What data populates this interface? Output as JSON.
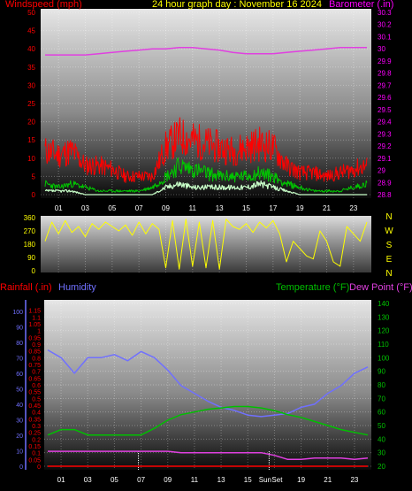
{
  "header": {
    "wind_label": "Windspeed (mph)",
    "title": "24 hour graph day : November 16 2024",
    "baro_label": "Barometer (.in)",
    "rain_label": "Rainfall (.in)",
    "humidity_label": "Humidity",
    "temp_label": "Temperature (°F)",
    "dew_label": "Dew Point (°F)"
  },
  "colors": {
    "wind": "#ff0000",
    "gust": "#ff0000",
    "wind_avg": "#00c800",
    "wind_low": "#c8ffc8",
    "barometer": "#e040e0",
    "direction": "#ffff00",
    "temperature": "#00c000",
    "dewpoint": "#e040e0",
    "humidity": "#7070ff",
    "rainfall": "#ff0000",
    "axis_left": "#ff0000",
    "axis_right": "#ff00ff",
    "hour_tick": "#ffffff"
  },
  "compass": [
    "N",
    "W",
    "S",
    "E",
    "N"
  ],
  "chart_data": [
    {
      "type": "line",
      "name": "wind",
      "x_ticks": [
        "01",
        "03",
        "05",
        "07",
        "09",
        "11",
        "13",
        "15",
        "17",
        "19",
        "21",
        "23"
      ],
      "y_left_ticks": [
        "0",
        "5",
        "10",
        "15",
        "20",
        "25",
        "30",
        "35",
        "40",
        "45",
        "50"
      ],
      "y_right_ticks": [
        "28.8",
        "28.9",
        "29",
        "29.1",
        "29.2",
        "29.3",
        "29.4",
        "29.5",
        "29.6",
        "29.7",
        "29.8",
        "29.9",
        "30",
        "30.1",
        "30.2",
        "30.3"
      ],
      "ylim_left": [
        0,
        50
      ],
      "ylim_right": [
        28.8,
        30.3
      ],
      "hours": [
        0,
        1,
        2,
        3,
        4,
        5,
        6,
        7,
        8,
        9,
        10,
        11,
        12,
        13,
        14,
        15,
        16,
        17,
        18,
        19,
        20,
        21,
        22,
        23,
        24
      ],
      "gust": [
        12,
        11,
        12,
        8,
        8,
        7,
        5,
        5,
        5,
        13,
        16,
        15,
        14,
        13,
        12,
        13,
        14,
        13,
        8,
        6,
        6,
        5,
        6,
        7,
        8
      ],
      "wind_avg": [
        3,
        2,
        3,
        2,
        1,
        1,
        1,
        1,
        2,
        5,
        8,
        7,
        6,
        5,
        5,
        5,
        6,
        5,
        3,
        2,
        1,
        1,
        1,
        2,
        3
      ],
      "wind_low": [
        1,
        1,
        1,
        0,
        0,
        0,
        0,
        0,
        0,
        2,
        3,
        2,
        2,
        2,
        2,
        2,
        3,
        2,
        1,
        0,
        0,
        0,
        0,
        0,
        0
      ],
      "barometer": [
        29.95,
        29.95,
        29.95,
        29.95,
        29.96,
        29.97,
        29.98,
        29.99,
        30.0,
        30.0,
        30.01,
        30.01,
        30.0,
        29.99,
        29.97,
        29.96,
        29.96,
        29.96,
        29.97,
        29.98,
        29.99,
        30.0,
        30.01,
        30.01,
        30.01
      ]
    },
    {
      "type": "line",
      "name": "wind-direction",
      "x_ticks": [
        "01",
        "03",
        "05",
        "07",
        "09",
        "11",
        "13",
        "15",
        "17",
        "19",
        "21",
        "23"
      ],
      "y_ticks": [
        "0",
        "90",
        "180",
        "270",
        "360"
      ],
      "ylim": [
        0,
        360
      ],
      "hours": [
        0,
        0.5,
        1,
        1.5,
        2,
        2.5,
        3,
        3.5,
        4,
        4.5,
        5,
        5.5,
        6,
        6.5,
        7,
        7.5,
        8,
        8.5,
        9,
        9.5,
        10,
        10.5,
        11,
        11.5,
        12,
        12.5,
        13,
        13.5,
        14,
        14.5,
        15,
        15.5,
        16,
        16.5,
        17,
        17.5,
        18,
        18.5,
        19,
        19.5,
        20,
        20.5,
        21,
        21.5,
        22,
        22.5,
        23,
        23.5,
        24
      ],
      "direction": [
        200,
        330,
        250,
        340,
        260,
        300,
        230,
        320,
        280,
        330,
        300,
        270,
        310,
        240,
        330,
        250,
        320,
        280,
        20,
        340,
        10,
        350,
        30,
        330,
        20,
        340,
        10,
        350,
        300,
        280,
        320,
        260,
        330,
        290,
        340,
        250,
        60,
        200,
        150,
        100,
        80,
        270,
        200,
        60,
        30,
        300,
        250,
        200,
        330
      ]
    },
    {
      "type": "line",
      "name": "temperature-humidity",
      "x_ticks": [
        "01",
        "03",
        "05",
        "07",
        "09",
        "11",
        "13",
        "15",
        "Sun",
        "Set",
        "19",
        "21",
        "23"
      ],
      "y_left_rain_ticks": [
        "0",
        "0.05",
        "0.1",
        "0.15",
        "0.2",
        "0.25",
        "0.3",
        "0.35",
        "0.4",
        "0.45",
        "0.5",
        "0.55",
        "0.6",
        "0.65",
        "0.7",
        "0.75",
        "0.8",
        "0.85",
        "0.9",
        "0.95",
        "1",
        "1.05",
        "1.1",
        "1.15"
      ],
      "y_left_humidity_ticks": [
        "0",
        "10",
        "20",
        "30",
        "40",
        "50",
        "60",
        "70",
        "80",
        "90",
        "100"
      ],
      "y_right_ticks": [
        "20",
        "30",
        "40",
        "50",
        "60",
        "70",
        "80",
        "90",
        "100",
        "110",
        "120",
        "130",
        "140"
      ],
      "ylim_rain": [
        0,
        1.2
      ],
      "ylim_humidity": [
        0,
        105
      ],
      "ylim_temp": [
        20,
        140
      ],
      "hours": [
        0,
        1,
        2,
        3,
        4,
        5,
        6,
        7,
        8,
        9,
        10,
        11,
        12,
        13,
        14,
        15,
        16,
        17,
        18,
        19,
        20,
        21,
        22,
        23,
        24
      ],
      "temperature": [
        43,
        47,
        47,
        43,
        43,
        43,
        43,
        43,
        48,
        54,
        58,
        60,
        62,
        63,
        64,
        64,
        63,
        61,
        58,
        56,
        53,
        50,
        47,
        45,
        43
      ],
      "dewpoint": [
        31,
        31,
        31,
        31,
        31,
        31,
        31,
        31,
        31,
        31,
        30,
        30,
        30,
        30,
        30,
        30,
        30,
        28,
        25,
        25,
        26,
        26,
        26,
        25,
        26
      ],
      "humidity": [
        75,
        70,
        60,
        70,
        70,
        72,
        68,
        74,
        70,
        62,
        52,
        47,
        42,
        38,
        36,
        33,
        32,
        33,
        34,
        38,
        40,
        47,
        52,
        60,
        64
      ],
      "rainfall": [
        0,
        0,
        0,
        0,
        0,
        0,
        0,
        0,
        0,
        0,
        0,
        0,
        0,
        0,
        0,
        0,
        0,
        0,
        0,
        0,
        0,
        0,
        0,
        0,
        0
      ]
    }
  ]
}
